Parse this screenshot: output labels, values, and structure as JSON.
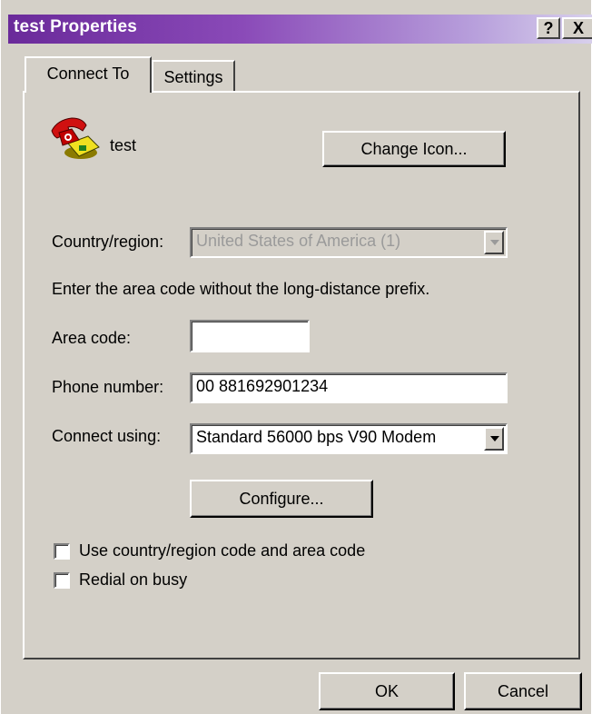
{
  "window": {
    "title": "test Properties",
    "help_button": "?",
    "close_button": "X"
  },
  "tabs": [
    {
      "label": "Connect To",
      "active": true
    },
    {
      "label": "Settings",
      "active": false
    }
  ],
  "connection": {
    "icon": "telephone-icon",
    "name": "test",
    "change_icon_label": "Change Icon..."
  },
  "form": {
    "country_label": "Country/region:",
    "country_value": "United States of America (1)",
    "area_hint": "Enter the area code without the long-distance prefix.",
    "area_code_label": "Area code:",
    "area_code_value": "",
    "phone_label": "Phone number:",
    "phone_value": "00 881692901234",
    "connect_label": "Connect using:",
    "connect_value": "Standard 56000 bps V90 Modem",
    "configure_label": "Configure..."
  },
  "options": [
    {
      "label": "Use country/region code and area code",
      "checked": false
    },
    {
      "label": "Redial on busy",
      "checked": false
    }
  ],
  "footer": {
    "ok_label": "OK",
    "cancel_label": "Cancel"
  }
}
